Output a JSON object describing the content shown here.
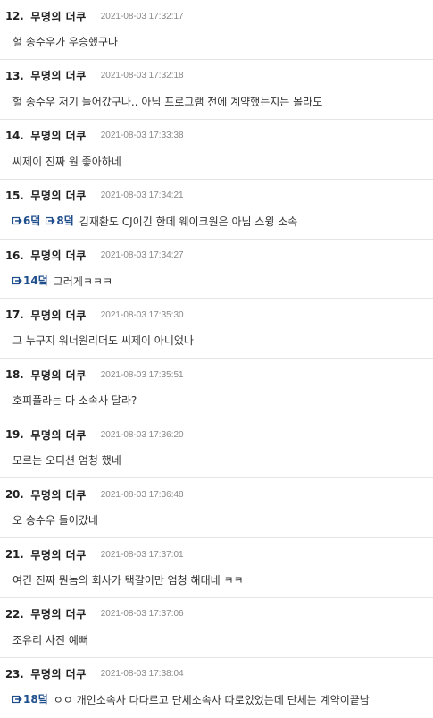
{
  "comments": [
    {
      "num": "12.",
      "author": "무명의 더쿠",
      "time": "2021-08-03 17:32:17",
      "refs": [],
      "text": "헐 송수우가 우승했구나"
    },
    {
      "num": "13.",
      "author": "무명의 더쿠",
      "time": "2021-08-03 17:32:18",
      "refs": [],
      "text": "헐 송수우 저기 들어갔구나.. 아님 프로그램 전에 계약했는지는 몰라도"
    },
    {
      "num": "14.",
      "author": "무명의 더쿠",
      "time": "2021-08-03 17:33:38",
      "refs": [],
      "text": "씨제이 진짜 원 좋아하네"
    },
    {
      "num": "15.",
      "author": "무명의 더쿠",
      "time": "2021-08-03 17:34:21",
      "refs": [
        "6덬",
        "8덬"
      ],
      "text": "김재환도 CJ이긴 한데 웨이크원은 아님 스윙 소속"
    },
    {
      "num": "16.",
      "author": "무명의 더쿠",
      "time": "2021-08-03 17:34:27",
      "refs": [
        "14덬"
      ],
      "text": "그러게ㅋㅋㅋ"
    },
    {
      "num": "17.",
      "author": "무명의 더쿠",
      "time": "2021-08-03 17:35:30",
      "refs": [],
      "text": "그 누구지 워너원리더도 씨제이 아니었나"
    },
    {
      "num": "18.",
      "author": "무명의 더쿠",
      "time": "2021-08-03 17:35:51",
      "refs": [],
      "text": "호피폴라는 다 소속사 달라?"
    },
    {
      "num": "19.",
      "author": "무명의 더쿠",
      "time": "2021-08-03 17:36:20",
      "refs": [],
      "text": "모르는 오디션 엄청 했네"
    },
    {
      "num": "20.",
      "author": "무명의 더쿠",
      "time": "2021-08-03 17:36:48",
      "refs": [],
      "text": "오 송수우 들어갔네"
    },
    {
      "num": "21.",
      "author": "무명의 더쿠",
      "time": "2021-08-03 17:37:01",
      "refs": [],
      "text": "여긴 진짜 뭔놈의 회사가 택갈이만 엄청 해대네 ㅋㅋ"
    },
    {
      "num": "22.",
      "author": "무명의 더쿠",
      "time": "2021-08-03 17:37:06",
      "refs": [],
      "text": "조유리 사진 예뻐"
    },
    {
      "num": "23.",
      "author": "무명의 더쿠",
      "time": "2021-08-03 17:38:04",
      "refs": [
        "18덬"
      ],
      "text": "ㅇㅇ 개인소속사 다다르고 단체소속사 따로있었는데 단체는 계약이끝남"
    }
  ],
  "colors": {
    "reply_ref": "#1f4e8c",
    "timestamp": "#888888",
    "divider": "#e4e4e4"
  },
  "icons": {
    "reply_ref": "reply-arrow-icon"
  }
}
